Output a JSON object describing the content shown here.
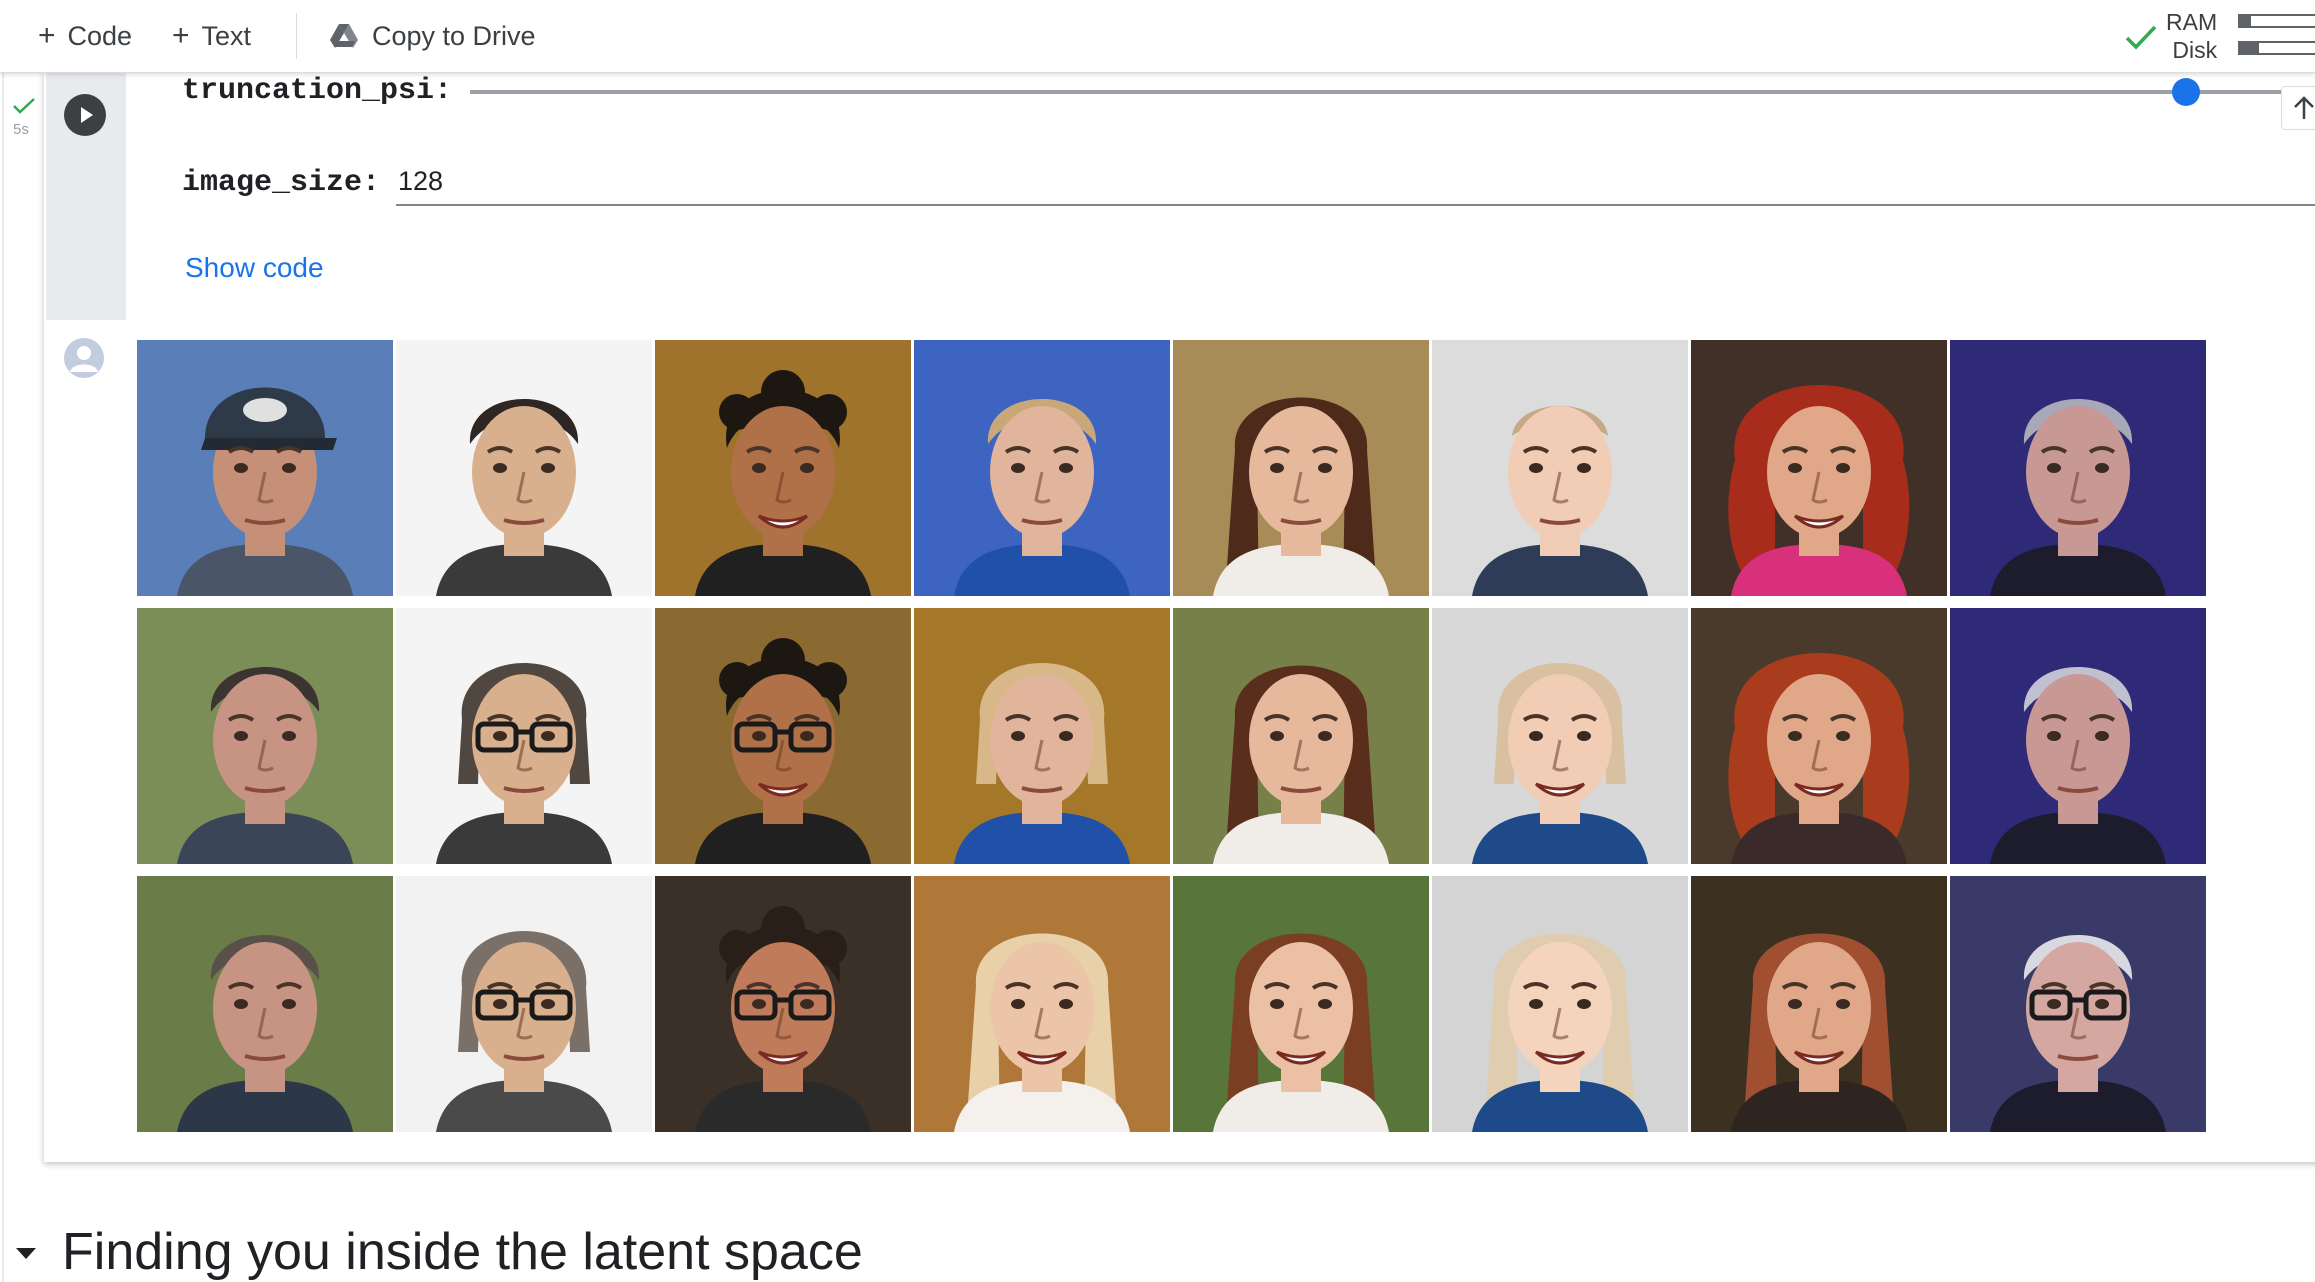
{
  "toolbar": {
    "add_code_label": "Code",
    "add_text_label": "Text",
    "copy_to_drive_label": "Copy to Drive"
  },
  "resources": {
    "ram_label": "RAM",
    "disk_label": "Disk",
    "ram_usage_fraction": 0.12,
    "disk_usage_fraction": 0.22,
    "status_icon": "check-icon",
    "status_color": "#34a853"
  },
  "cell": {
    "exec_time": "5s",
    "run_icon": "play-icon",
    "params": {
      "truncation_psi_label": "truncation_psi:",
      "truncation_psi_fraction": 0.93,
      "image_size_label": "image_size:",
      "image_size_value": "128"
    },
    "show_code_label": "Show code",
    "scroll_icon": "arrow-up-icon"
  },
  "output": {
    "output_icon": "user-avatar-icon",
    "grid": {
      "rows": 3,
      "columns": 8
    },
    "faces": [
      {
        "name": "face-man-cap",
        "bg": "#5a7fb8",
        "skin": "#c69078",
        "hair": "#2f3a48",
        "shirt": "#4a5568",
        "style": "cap",
        "glasses": false
      },
      {
        "name": "face-asian-man",
        "bg": "#f4f4f4",
        "skin": "#d8b08e",
        "hair": "#2d2622",
        "shirt": "#3a3a3a",
        "style": "short",
        "glasses": false
      },
      {
        "name": "face-smiling-man",
        "bg": "#a0732c",
        "skin": "#b07048",
        "hair": "#1d1712",
        "shirt": "#202020",
        "style": "curly",
        "glasses": false,
        "smile": true
      },
      {
        "name": "face-blonde-woman",
        "bg": "#3d64c0",
        "skin": "#e0b59b",
        "hair": "#c8a878",
        "shirt": "#2050a8",
        "style": "short",
        "glasses": false
      },
      {
        "name": "face-brunette-woman",
        "bg": "#a88c58",
        "skin": "#e6b89c",
        "hair": "#4e2a1a",
        "shirt": "#f0ece8",
        "style": "long",
        "glasses": false
      },
      {
        "name": "face-baby",
        "bg": "#dcdcdc",
        "skin": "#f0cdb4",
        "hair": "#c6a888",
        "shirt": "#2e3c58",
        "style": "baby",
        "glasses": false
      },
      {
        "name": "face-redhead-woman",
        "bg": "#403028",
        "skin": "#e0a888",
        "hair": "#a82c1c",
        "shirt": "#d8307a",
        "style": "curly-long",
        "glasses": false,
        "smile": true
      },
      {
        "name": "face-older-man",
        "bg": "#2e2a78",
        "skin": "#c89894",
        "hair": "#a8a8b8",
        "shirt": "#1c1c2c",
        "style": "short",
        "glasses": false
      },
      {
        "name": "face-man-row2",
        "bg": "#7c8e58",
        "skin": "#c79484",
        "hair": "#3c3430",
        "shirt": "#3a4658",
        "style": "short",
        "glasses": false
      },
      {
        "name": "face-asian-glasses",
        "bg": "#f4f4f4",
        "skin": "#d8b08e",
        "hair": "#504840",
        "shirt": "#3a3a3a",
        "style": "bob",
        "glasses": true
      },
      {
        "name": "face-smiling-glasses",
        "bg": "#8a6a30",
        "skin": "#b07048",
        "hair": "#1d1712",
        "shirt": "#202020",
        "style": "curly",
        "glasses": true,
        "smile": true
      },
      {
        "name": "face-blonde-row2",
        "bg": "#a47828",
        "skin": "#e0b59b",
        "hair": "#d8b888",
        "shirt": "#2050a8",
        "style": "bob",
        "glasses": false
      },
      {
        "name": "face-brunette-bangs",
        "bg": "#78804a",
        "skin": "#e6b89c",
        "hair": "#5a2e1c",
        "shirt": "#f0ece8",
        "style": "long",
        "glasses": false
      },
      {
        "name": "face-toddler",
        "bg": "#d8d8d8",
        "skin": "#f0cdb4",
        "hair": "#d8c0a0",
        "shirt": "#1e4a8a",
        "style": "bob",
        "glasses": false,
        "smile": true
      },
      {
        "name": "face-redhead-row2",
        "bg": "#4a3a2c",
        "skin": "#e0a888",
        "hair": "#a83c1c",
        "shirt": "#3a2a2a",
        "style": "curly-long",
        "glasses": false,
        "smile": true
      },
      {
        "name": "face-older-man-row2",
        "bg": "#2e2a78",
        "skin": "#c89894",
        "hair": "#c0c0d0",
        "shirt": "#1c1c2c",
        "style": "short",
        "glasses": false
      },
      {
        "name": "face-man-row3",
        "bg": "#6a7c48",
        "skin": "#c79484",
        "hair": "#5a504a",
        "shirt": "#2c3848",
        "style": "short",
        "glasses": false
      },
      {
        "name": "face-woman-glasses",
        "bg": "#f2f2f2",
        "skin": "#d8b08e",
        "hair": "#7a7068",
        "shirt": "#4a4a4a",
        "style": "bob",
        "glasses": true
      },
      {
        "name": "face-young-glasses",
        "bg": "#3a3028",
        "skin": "#c07c5a",
        "hair": "#2a1e18",
        "shirt": "#2a2a2a",
        "style": "curly",
        "glasses": true,
        "smile": true
      },
      {
        "name": "face-blonde-smile",
        "bg": "#b07838",
        "skin": "#ecc4a8",
        "hair": "#e8d0a8",
        "shirt": "#f4f0ec",
        "style": "long",
        "glasses": false,
        "smile": true
      },
      {
        "name": "face-woman-smile",
        "bg": "#58763a",
        "skin": "#ecc0a4",
        "hair": "#7a3e22",
        "shirt": "#f0ece8",
        "style": "long",
        "glasses": false,
        "smile": true
      },
      {
        "name": "face-girl",
        "bg": "#d4d4d4",
        "skin": "#f4d4bc",
        "hair": "#e0cdb0",
        "shirt": "#1e4a8a",
        "style": "long",
        "glasses": false,
        "smile": true
      },
      {
        "name": "face-woman-auburn",
        "bg": "#3c3020",
        "skin": "#e0a888",
        "hair": "#a05030",
        "shirt": "#2e2420",
        "style": "long",
        "glasses": false,
        "smile": true
      },
      {
        "name": "face-elder-glasses",
        "bg": "#3a3a68",
        "skin": "#d4a8a0",
        "hair": "#d8d8e0",
        "shirt": "#1c1c2c",
        "style": "short",
        "glasses": true
      }
    ]
  },
  "section": {
    "title": "Finding you inside the latent space",
    "collapse_icon": "caret-down-icon"
  }
}
